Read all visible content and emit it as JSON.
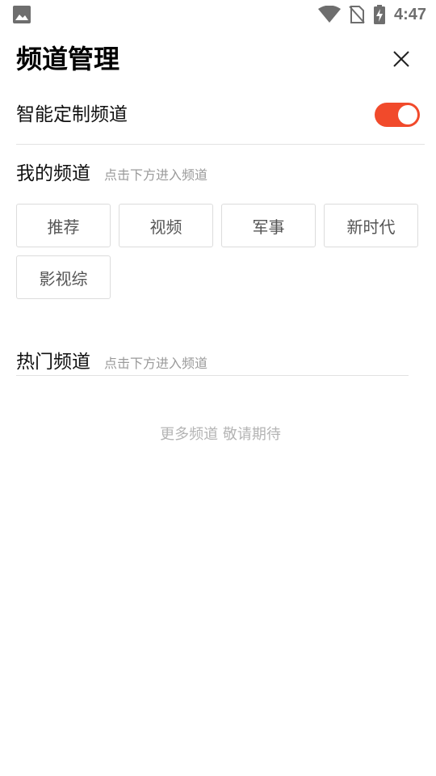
{
  "status_bar": {
    "time": "4:47",
    "icons": [
      "image-icon",
      "wifi-icon",
      "no-sim-icon",
      "battery-charging-icon"
    ]
  },
  "header": {
    "title": "频道管理",
    "close_icon": "close-icon"
  },
  "smart_channel": {
    "label": "智能定制频道",
    "enabled": true
  },
  "my_channels": {
    "title": "我的频道",
    "hint": "点击下方进入频道",
    "items": [
      "推荐",
      "视频",
      "军事",
      "新时代",
      "影视综"
    ]
  },
  "hot_channels": {
    "title": "热门频道",
    "hint": "点击下方进入频道",
    "empty_text": "更多频道 敬请期待"
  },
  "colors": {
    "accent": "#f14a2b",
    "chip_border": "#dcdcdc",
    "hint_text": "#9a9a9a"
  }
}
